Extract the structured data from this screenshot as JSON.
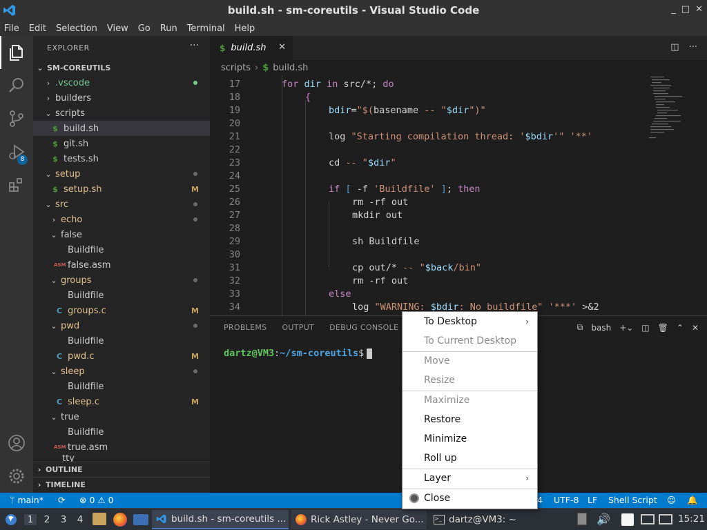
{
  "window": {
    "title": "build.sh - sm-coreutils - Visual Studio Code",
    "buttons": [
      "_",
      "□",
      "✕"
    ]
  },
  "menu": [
    "File",
    "Edit",
    "Selection",
    "View",
    "Go",
    "Run",
    "Terminal",
    "Help"
  ],
  "activity": {
    "source_control_badge": "8"
  },
  "sidebar": {
    "header": "EXPLORER",
    "more": "···",
    "root": "SM-COREUTILS",
    "items": [
      {
        "label": "builders"
      },
      {
        "label": "scripts"
      },
      {
        "label": "build.sh"
      },
      {
        "label": "git.sh"
      },
      {
        "label": "tests.sh"
      },
      {
        "label": "setup"
      },
      {
        "label": "setup.sh",
        "deco": "M"
      },
      {
        "label": "src"
      },
      {
        "label": "echo"
      },
      {
        "label": "false"
      },
      {
        "label": "Buildfile"
      },
      {
        "label": "false.asm"
      },
      {
        "label": "groups"
      },
      {
        "label": "Buildfile"
      },
      {
        "label": "groups.c",
        "deco": "M"
      },
      {
        "label": "pwd"
      },
      {
        "label": "Buildfile"
      },
      {
        "label": "pwd.c",
        "deco": "M"
      },
      {
        "label": "sleep"
      },
      {
        "label": "Buildfile"
      },
      {
        "label": "sleep.c",
        "deco": "M"
      },
      {
        "label": "true"
      },
      {
        "label": "Buildfile"
      },
      {
        "label": "true.asm"
      },
      {
        "label": "tty"
      }
    ],
    "vscode": ".vscode",
    "outline": "OUTLINE",
    "timeline": "TIMELINE"
  },
  "editor": {
    "tab": "build.sh",
    "breadcrumb": [
      "scripts",
      "build.sh"
    ],
    "line_numbers": [
      "17",
      "18",
      "19",
      "20",
      "21",
      "22",
      "23",
      "24",
      "25",
      "26",
      "27",
      "28",
      "29",
      "30",
      "31",
      "32",
      "33",
      "34"
    ]
  },
  "panel": {
    "tabs": [
      "PROBLEMS",
      "OUTPUT",
      "DEBUG CONSOLE"
    ],
    "shell": "bash",
    "prompt_user": "dartz@VM3",
    "prompt_path": "~/sm-coreutils",
    "prompt_end": "$"
  },
  "statusbar": {
    "branch": "main*",
    "errors": "0",
    "warnings": "0",
    "spaces": "4",
    "encoding": "UTF-8",
    "eol": "LF",
    "language": "Shell Script"
  },
  "taskbar": {
    "workspaces": [
      "1",
      "2",
      "3",
      "4"
    ],
    "tasks": [
      {
        "label": "build.sh - sm-coreutils ..."
      },
      {
        "label": "Rick Astley - Never Go..."
      },
      {
        "label": "dartz@VM3: ~"
      }
    ],
    "clock": "15:21"
  },
  "context_menu": {
    "items": [
      {
        "label": "To Desktop",
        "disabled": false,
        "submenu": true
      },
      {
        "label": "To Current Desktop",
        "disabled": true
      },
      {
        "label": "Move",
        "disabled": true
      },
      {
        "label": "Resize",
        "disabled": true
      },
      {
        "label": "Maximize",
        "disabled": true
      },
      {
        "label": "Restore",
        "disabled": false
      },
      {
        "label": "Minimize",
        "disabled": false
      },
      {
        "label": "Roll up",
        "disabled": false
      },
      {
        "label": "Layer",
        "disabled": false,
        "submenu": true
      },
      {
        "label": "Close",
        "disabled": false
      }
    ]
  }
}
